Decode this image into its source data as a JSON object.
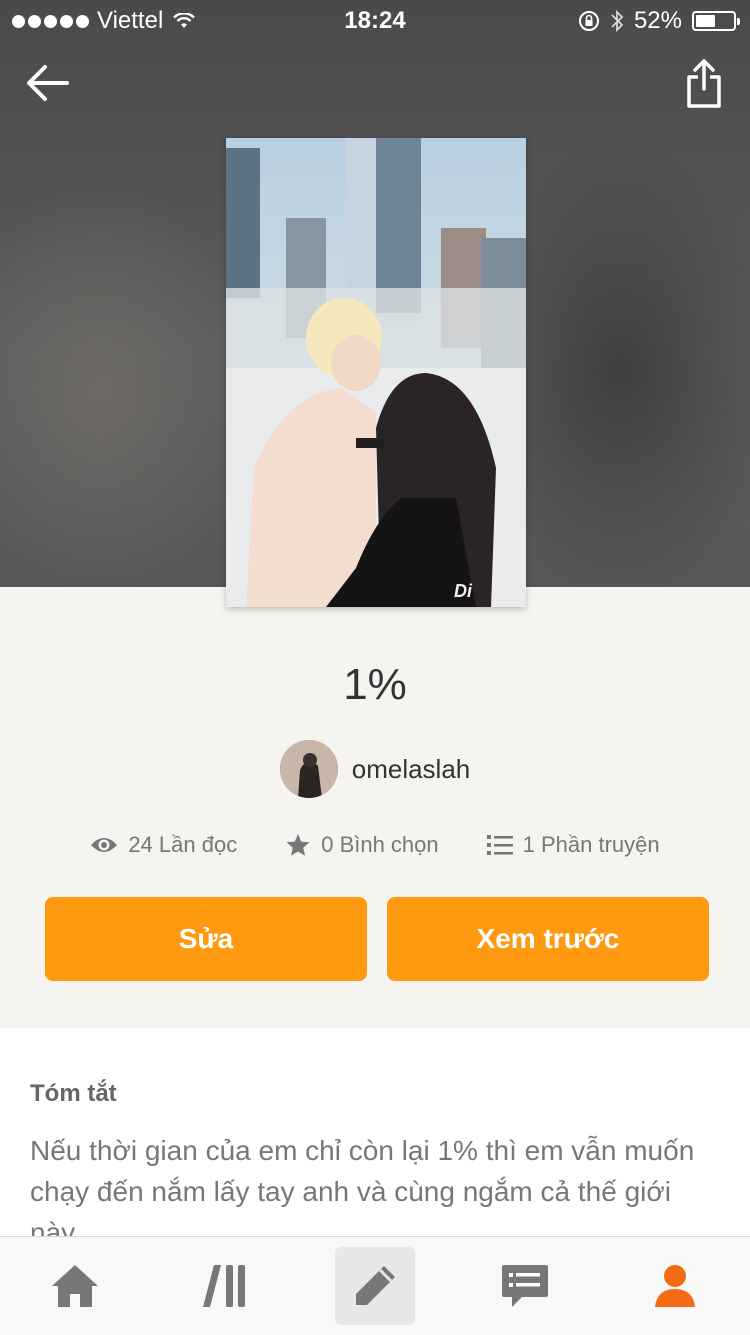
{
  "status_bar": {
    "carrier": "Viettel",
    "time": "18:24",
    "battery_percent": "52%",
    "battery_level": 0.52
  },
  "header": {
    "back_icon": "arrow-left-icon",
    "share_icon": "share-icon"
  },
  "story": {
    "title": "1%",
    "author": "omelaslah",
    "stats": {
      "reads": "24 Lần đọc",
      "votes": "0 Bình chọn",
      "parts": "1 Phần truyện"
    },
    "buttons": {
      "edit": "Sửa",
      "preview": "Xem trước"
    },
    "summary_label": "Tóm tắt",
    "summary_text": "Nếu thời gian của em chỉ còn lại 1% thì em vẫn muốn chạy đến nắm lấy tay anh và cùng ngắm cả thế giới này"
  },
  "tabbar": {
    "items": [
      {
        "icon": "home-icon",
        "active": false
      },
      {
        "icon": "library-icon",
        "active": false
      },
      {
        "icon": "write-pencil-icon",
        "active": true
      },
      {
        "icon": "messages-icon",
        "active": false
      },
      {
        "icon": "profile-icon",
        "active": false
      }
    ]
  },
  "colors": {
    "accent": "#ff9a10",
    "profile_accent": "#f46b15"
  }
}
